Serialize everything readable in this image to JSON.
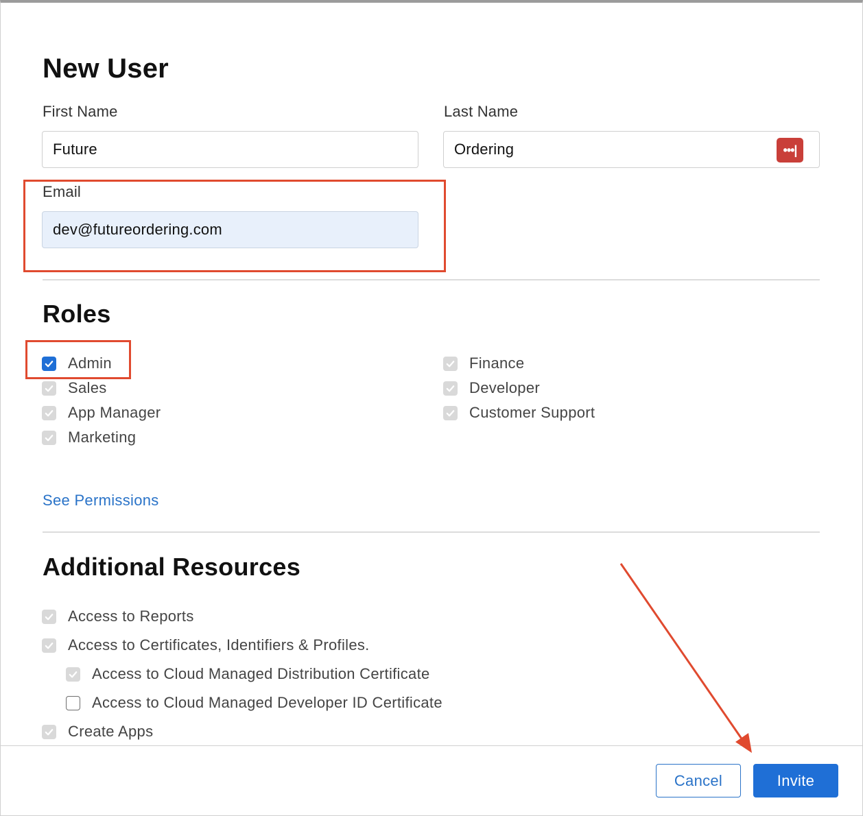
{
  "dialog": {
    "title": "New User",
    "first_name": {
      "label": "First Name",
      "value": "Future"
    },
    "last_name": {
      "label": "Last Name",
      "value": "Ordering",
      "password_manager_icon": "•••|"
    },
    "email": {
      "label": "Email",
      "value": "dev@futureordering.com"
    }
  },
  "roles": {
    "heading": "Roles",
    "left": [
      {
        "label": "Admin",
        "state": "checked"
      },
      {
        "label": "Sales",
        "state": "disabled-checked"
      },
      {
        "label": "App Manager",
        "state": "disabled-checked"
      },
      {
        "label": "Marketing",
        "state": "disabled-checked"
      }
    ],
    "right": [
      {
        "label": "Finance",
        "state": "disabled-checked"
      },
      {
        "label": "Developer",
        "state": "disabled-checked"
      },
      {
        "label": "Customer Support",
        "state": "disabled-checked"
      }
    ],
    "see_permissions": "See Permissions"
  },
  "additional_resources": {
    "heading": "Additional Resources",
    "items": [
      {
        "label": "Access to Reports",
        "state": "disabled-checked"
      },
      {
        "label": "Access to Certificates, Identifiers & Profiles.",
        "state": "disabled-checked"
      },
      {
        "label": "Access to Cloud Managed Distribution Certificate",
        "state": "disabled-checked"
      },
      {
        "label": "Access to Cloud Managed Developer ID Certificate",
        "state": "unchecked"
      },
      {
        "label": "Create Apps",
        "state": "disabled-checked"
      }
    ]
  },
  "footer": {
    "cancel_label": "Cancel",
    "invite_label": "Invite"
  },
  "colors": {
    "accent": "#1f6fd6",
    "link": "#2a73c8",
    "annotation": "#e04a2f",
    "password_icon": "#c93f39"
  }
}
